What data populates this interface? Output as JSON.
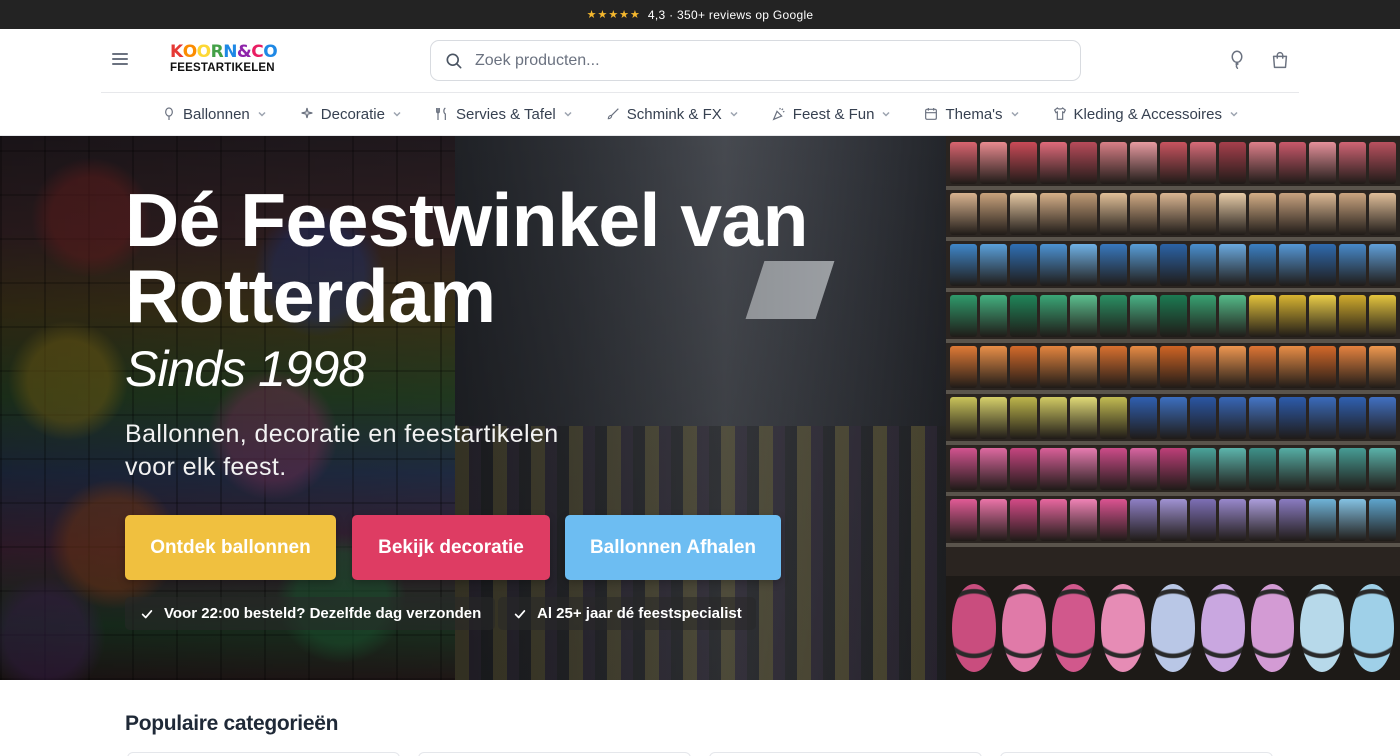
{
  "topbar": {
    "stars": "★★★★★",
    "reviews_text": "4,3 · 350+ reviews op Google",
    "star_color": "#f5b82e"
  },
  "header": {
    "logo": {
      "top": "KOORN&CO",
      "bottom": "FEESTARTIKELEN"
    },
    "search": {
      "placeholder": "Zoek producten...",
      "value": ""
    },
    "icons": [
      "menu-icon",
      "search-icon",
      "wishlist-icon",
      "cart-icon"
    ]
  },
  "nav": {
    "items": [
      {
        "label": "Ballonnen",
        "icon": "balloon-icon"
      },
      {
        "label": "Decoratie",
        "icon": "sparkle-icon"
      },
      {
        "label": "Servies & Tafel",
        "icon": "utensils-icon"
      },
      {
        "label": "Schmink & FX",
        "icon": "brush-icon"
      },
      {
        "label": "Feest & Fun",
        "icon": "party-popper-icon"
      },
      {
        "label": "Thema's",
        "icon": "calendar-icon"
      },
      {
        "label": "Kleding & Accessoires",
        "icon": "shirt-icon"
      }
    ]
  },
  "hero": {
    "title_line1": "Dé Feestwinkel van",
    "title_line2": "Rotterdam",
    "since": "Sinds 1998",
    "subtitle_line1": "Ballonnen, decoratie en feestartikelen",
    "subtitle_line2": "voor elk feest.",
    "buttons": [
      {
        "label": "Ontdek ballonnen",
        "color": "#f0c03f"
      },
      {
        "label": "Bekijk decoratie",
        "color": "#de3c63"
      },
      {
        "label": "Ballonnen Afhalen",
        "color": "#6dbdf2"
      }
    ],
    "usps": [
      "Voor 22:00 besteld? Dezelfde dag verzonden",
      "Al 25+ jaar dé feestspecialist"
    ]
  },
  "sections": {
    "popular_title": "Populaire categorieën"
  }
}
